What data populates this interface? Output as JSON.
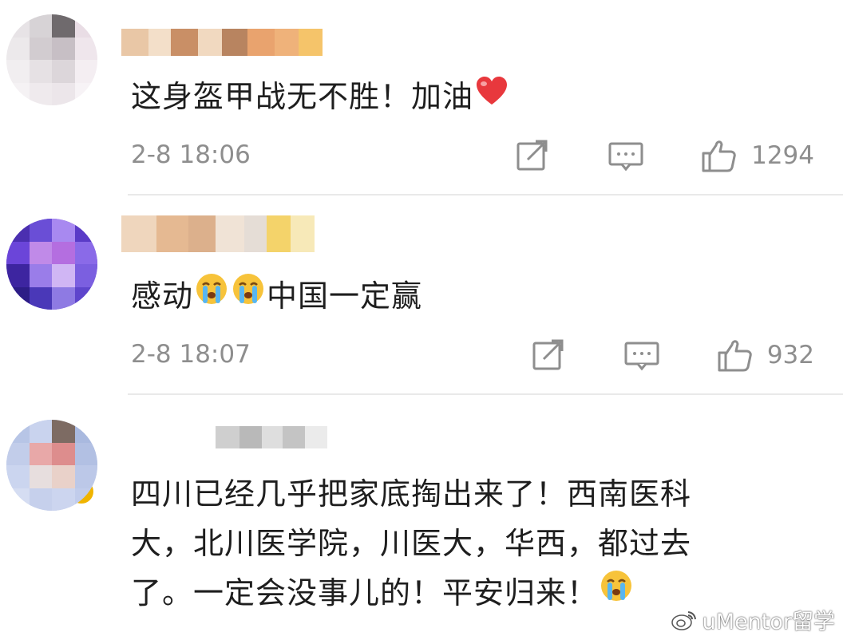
{
  "comments": [
    {
      "text": "这身盔甲战无不胜！加油",
      "emoji_suffix": "heart-emoji",
      "time": "2-8 18:06",
      "likes": "1294"
    },
    {
      "text_before": "感动",
      "emojis": [
        "crying-face-emoji",
        "crying-face-emoji"
      ],
      "text_after": "中国一定赢",
      "time": "2-8 18:07",
      "likes": "932",
      "verified": true
    },
    {
      "lines": [
        "四川已经几乎把家底掏出来了！西南医科",
        "大，北川医学院，川医大，华西，都过去",
        "了。一定会没事儿的！平安归来！"
      ],
      "emoji_suffix": "crying-face-emoji"
    }
  ],
  "icons": {
    "repost": "repost-icon",
    "reply": "comment-icon",
    "like": "thumbs-up-icon"
  },
  "watermark": {
    "text": "uMentor留学",
    "logo": "weibo-logo"
  },
  "colors": {
    "meta_gray": "#8e8e8e",
    "divider": "#e9e9e9",
    "heart": "#e8383d",
    "verify_badge": "#f0b400"
  }
}
